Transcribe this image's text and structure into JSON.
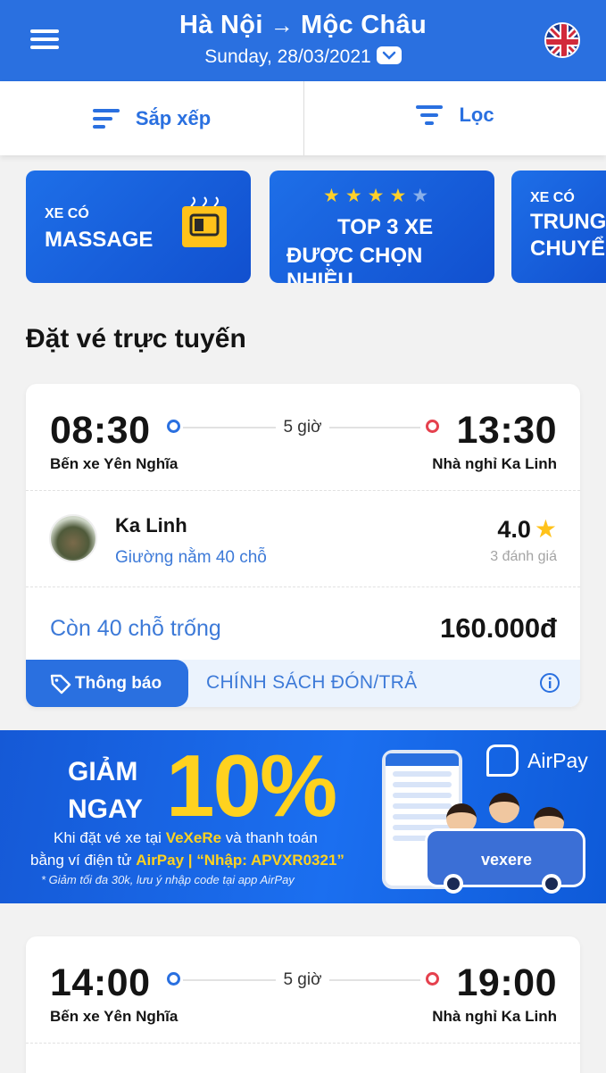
{
  "header": {
    "origin": "Hà Nội",
    "arrow": "→",
    "destination": "Mộc Châu",
    "date": "Sunday, 28/03/2021"
  },
  "toolbar": {
    "sort_label": "Sắp xếp",
    "filter_label": "Lọc"
  },
  "promos": [
    {
      "small": "XE CÓ",
      "big": "MASSAGE"
    },
    {
      "line1": "TOP 3 XE",
      "line2": "ĐƯỢC CHỌN NHIỀU",
      "stars_filled": 4,
      "stars_total": 5
    },
    {
      "small": "XE CÓ",
      "big1": "TRUNG",
      "big2": "CHUYỂN"
    }
  ],
  "section_title": "Đặt vé trực tuyến",
  "trips": [
    {
      "depart_time": "08:30",
      "depart_station": "Bến xe Yên Nghĩa",
      "duration": "5 giờ",
      "arrive_time": "13:30",
      "arrive_station": "Nhà nghỉ Ka Linh",
      "operator": "Ka Linh",
      "bus_type": "Giường nằm 40 chỗ",
      "rating": "4.0",
      "reviews": "3 đánh giá",
      "seats_left": "Còn 40 chỗ trống",
      "price": "160.000đ",
      "notice_label": "Thông báo",
      "policy_label": "CHÍNH SÁCH ĐÓN/TRẢ"
    },
    {
      "depart_time": "14:00",
      "depart_station": "Bến xe Yên Nghĩa",
      "duration": "5 giờ",
      "arrive_time": "19:00",
      "arrive_station": "Nhà nghỉ Ka Linh"
    }
  ],
  "banner": {
    "giam": "GIẢM",
    "ngay": "NGAY",
    "percent": "10%",
    "line1_a": "Khi đặt vé xe tại ",
    "line1_b": "VeXeRe",
    "line1_c": " và thanh toán",
    "line2_a": "bằng ví điện tử ",
    "line2_b": "AirPay | “Nhập: APVXR0321”",
    "line3": "* Giảm tối đa 30k, lưu ý nhập code tại app AirPay",
    "airpay": "AirPay",
    "van_brand": "vexere"
  },
  "colors": {
    "primary": "#2a70e0",
    "accent_yellow": "#ffd21f",
    "arrival_dot": "#e5414e"
  }
}
